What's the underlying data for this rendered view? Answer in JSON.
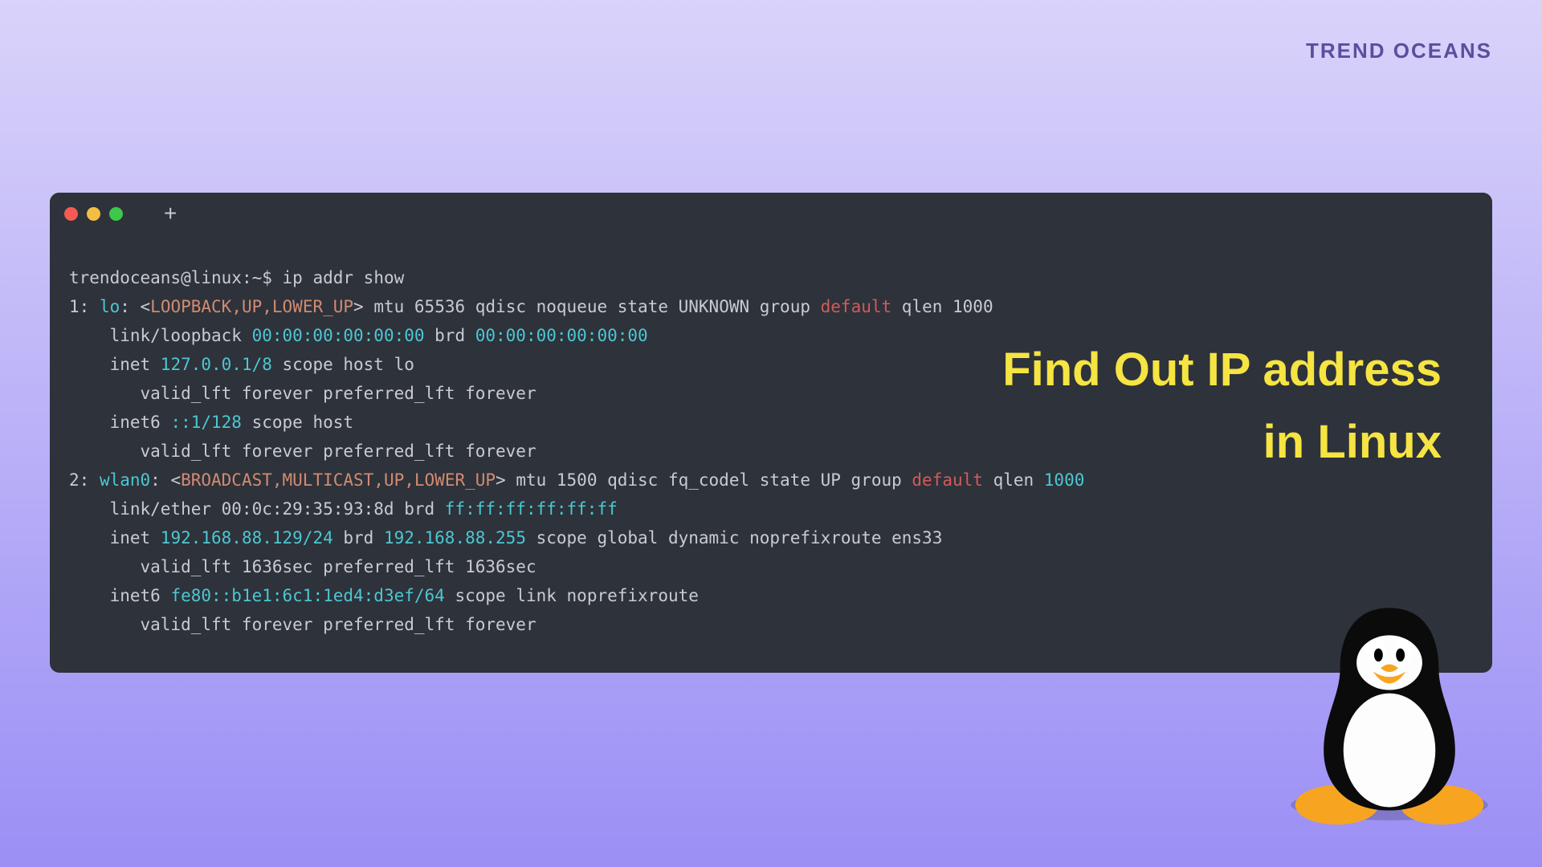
{
  "brand": "TREND OCEANS",
  "overlay": {
    "line1": "Find Out IP address",
    "line2": "in Linux"
  },
  "terminal": {
    "plus": "+",
    "prompt_user": "trendoceans@linux",
    "prompt_sep": ":~$",
    "command": "ip addr show",
    "l1_a": "1: ",
    "l1_b": "lo",
    "l1_c": ": <",
    "l1_d": "LOOPBACK,UP,LOWER_UP",
    "l1_e": "> mtu 65536 qdisc noqueue state UNKNOWN group ",
    "l1_f": "default",
    "l1_g": " qlen 1000",
    "l2_a": "    link/loopback ",
    "l2_b": "00:00:00:00:00:00",
    "l2_c": " brd ",
    "l2_d": "00:00:00:00:00:00",
    "l3_a": "    inet ",
    "l3_b": "127.0.0.1/8",
    "l3_c": " scope host lo",
    "l4": "       valid_lft forever preferred_lft forever",
    "l5_a": "    inet6 ",
    "l5_b": "::1/128",
    "l5_c": " scope host",
    "l6": "       valid_lft forever preferred_lft forever",
    "l7_a": "2: ",
    "l7_b": "wlan0",
    "l7_c": ": <",
    "l7_d": "BROADCAST,MULTICAST,UP,LOWER_UP",
    "l7_e": "> mtu 1500 qdisc fq_codel state UP group ",
    "l7_f": "default",
    "l7_g": " qlen ",
    "l7_h": "1000",
    "l8_a": "    link/ether 00:0c:29:35:93:8d brd ",
    "l8_b": "ff:ff:ff:ff:ff:ff",
    "l9_a": "    inet ",
    "l9_b": "192.168.88.129/24",
    "l9_c": " brd ",
    "l9_d": "192.168.88.255",
    "l9_e": " scope global dynamic noprefixroute ens33",
    "l10": "       valid_lft 1636sec preferred_lft 1636sec",
    "l11_a": "    inet6 ",
    "l11_b": "fe80::b1e1:6c1:1ed4:d3ef/64",
    "l11_c": " scope link noprefixroute",
    "l12": "       valid_lft forever preferred_lft forever"
  }
}
